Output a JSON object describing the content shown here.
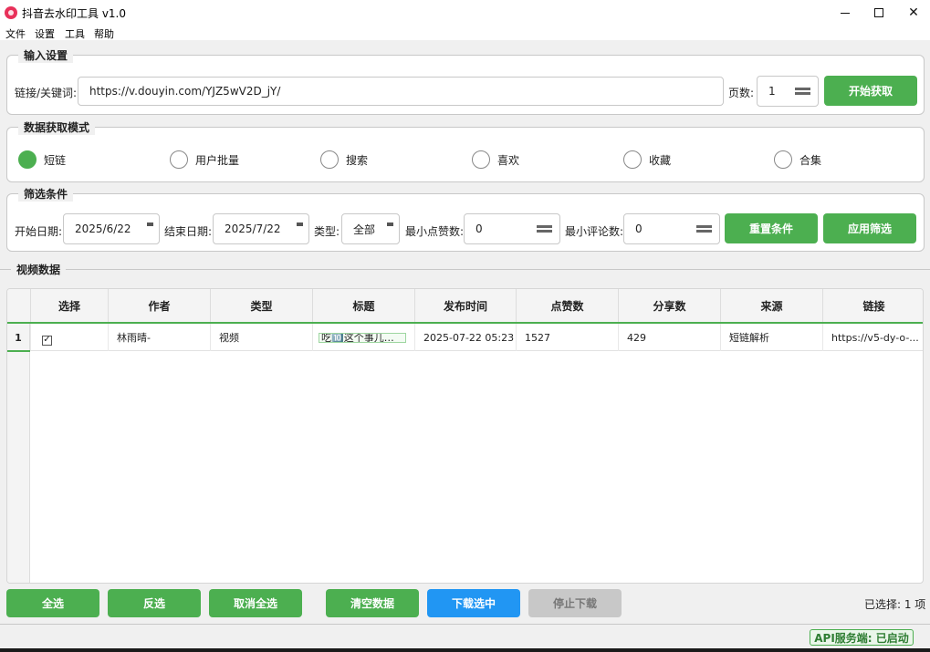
{
  "window": {
    "title": "抖音去水印工具 v1.0",
    "controls": {
      "minimize": "minimize-icon",
      "maximize": "maximize-icon",
      "close": "close-icon"
    }
  },
  "menu": [
    "文件",
    "设置",
    "工具",
    "帮助"
  ],
  "input_settings": {
    "legend": "输入设置",
    "link_label": "链接/关键词:",
    "link_value": "https://v.douyin.com/YJZ5wV2D_jY/",
    "pages_label": "页数:",
    "pages_value": "1",
    "start_button": "开始获取"
  },
  "mode": {
    "legend": "数据获取模式",
    "options": [
      {
        "label": "短链",
        "checked": true
      },
      {
        "label": "用户批量",
        "checked": false
      },
      {
        "label": "搜索",
        "checked": false
      },
      {
        "label": "喜欢",
        "checked": false
      },
      {
        "label": "收藏",
        "checked": false
      },
      {
        "label": "合集",
        "checked": false
      }
    ]
  },
  "filters": {
    "legend": "筛选条件",
    "start_date_label": "开始日期:",
    "start_date": "2025/6/22",
    "end_date_label": "结束日期:",
    "end_date": "2025/7/22",
    "type_label": "类型:",
    "type_value": "全部",
    "min_likes_label": "最小点赞数:",
    "min_likes": "0",
    "min_comments_label": "最小评论数:",
    "min_comments": "0",
    "reset_button": "重置条件",
    "apply_button": "应用筛选"
  },
  "video_data": {
    "legend": "视频数据",
    "columns": [
      "选择",
      "作者",
      "类型",
      "标题",
      "发布时间",
      "点赞数",
      "分享数",
      "来源",
      "链接"
    ],
    "rows": [
      {
        "num": "1",
        "checked": "✓",
        "author": "林雨晴-",
        "type": "视频",
        "title": "吃🔟这个事儿一...",
        "publish_time": "2025-07-22 05:23",
        "likes": "1527",
        "shares": "429",
        "source": "短链解析",
        "link": "https://v5-dy-o-..."
      }
    ]
  },
  "actions": {
    "select_all": "全选",
    "invert": "反选",
    "deselect_all": "取消全选",
    "clear": "清空数据",
    "download": "下载选中",
    "stop": "停止下载"
  },
  "status": {
    "selected": "已选择: 1 项",
    "api": "API服务端: 已启动"
  },
  "colors": {
    "accent": "#4caf50",
    "primary": "#2196f3",
    "disabled": "#c8c8c8"
  }
}
